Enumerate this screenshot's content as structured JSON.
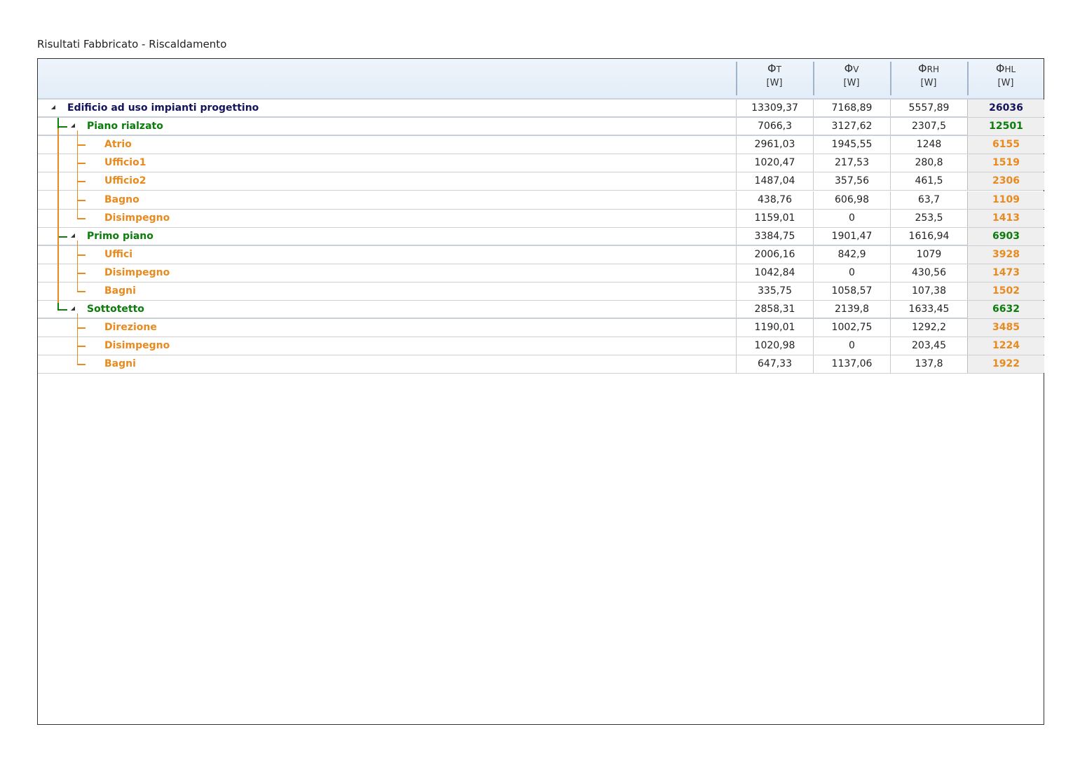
{
  "title": "Risultati Fabbricato - Riscaldamento",
  "colors": {
    "building": "#14145c",
    "floor": "#0a7d0a",
    "room": "#e98a1e"
  },
  "icons": {
    "expander": "collapse-triangle-icon"
  },
  "columns": [
    {
      "symbol": "Φ",
      "sub": "T",
      "unit": "[W]"
    },
    {
      "symbol": "Φ",
      "sub": "V",
      "unit": "[W]"
    },
    {
      "symbol": "Φ",
      "sub": "RH",
      "unit": "[W]"
    },
    {
      "symbol": "Φ",
      "sub": "HL",
      "unit": "[W]"
    }
  ],
  "rows": [
    {
      "level": 0,
      "name": "Edificio ad uso impianti progettino",
      "values": [
        "13309,37",
        "7168,89",
        "5557,89",
        "26036"
      ]
    },
    {
      "level": 1,
      "name": "Piano rialzato",
      "values": [
        "7066,3",
        "3127,62",
        "2307,5",
        "12501"
      ]
    },
    {
      "level": 2,
      "name": "Atrio",
      "values": [
        "2961,03",
        "1945,55",
        "1248",
        "6155"
      ]
    },
    {
      "level": 2,
      "name": "Ufficio1",
      "values": [
        "1020,47",
        "217,53",
        "280,8",
        "1519"
      ]
    },
    {
      "level": 2,
      "name": "Ufficio2",
      "values": [
        "1487,04",
        "357,56",
        "461,5",
        "2306"
      ]
    },
    {
      "level": 2,
      "name": "Bagno",
      "values": [
        "438,76",
        "606,98",
        "63,7",
        "1109"
      ]
    },
    {
      "level": 2,
      "name": "Disimpegno",
      "values": [
        "1159,01",
        "0",
        "253,5",
        "1413"
      ]
    },
    {
      "level": 1,
      "name": "Primo piano",
      "values": [
        "3384,75",
        "1901,47",
        "1616,94",
        "6903"
      ]
    },
    {
      "level": 2,
      "name": "Uffici",
      "values": [
        "2006,16",
        "842,9",
        "1079",
        "3928"
      ]
    },
    {
      "level": 2,
      "name": "Disimpegno",
      "values": [
        "1042,84",
        "0",
        "430,56",
        "1473"
      ]
    },
    {
      "level": 2,
      "name": "Bagni",
      "values": [
        "335,75",
        "1058,57",
        "107,38",
        "1502"
      ]
    },
    {
      "level": 1,
      "name": "Sottotetto",
      "values": [
        "2858,31",
        "2139,8",
        "1633,45",
        "6632"
      ]
    },
    {
      "level": 2,
      "name": "Direzione",
      "values": [
        "1190,01",
        "1002,75",
        "1292,2",
        "3485"
      ]
    },
    {
      "level": 2,
      "name": "Disimpegno",
      "values": [
        "1020,98",
        "0",
        "203,45",
        "1224"
      ]
    },
    {
      "level": 2,
      "name": "Bagni",
      "values": [
        "647,33",
        "1137,06",
        "137,8",
        "1922"
      ]
    }
  ]
}
